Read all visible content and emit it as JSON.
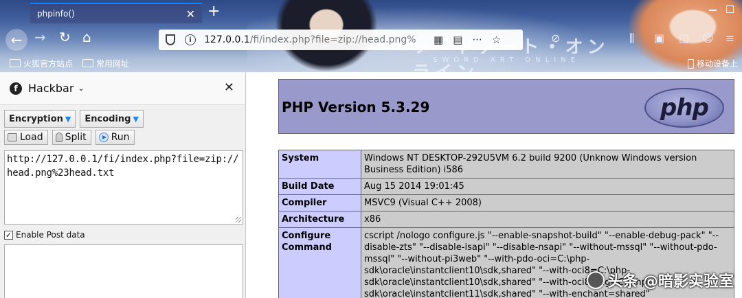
{
  "browser": {
    "tab_title": "phpinfo()",
    "tab_close": "✕",
    "new_tab": "+",
    "url_host": "127.0.0.1",
    "url_path": "/fi/index.php?file=zip://head.png%",
    "bookmarks": [
      "火狐官方站点",
      "常用网址"
    ],
    "mobile_bookmarks": "移动设备上",
    "theme_logo_jp": "ソードアート・オンライン",
    "theme_logo_en": "SWORD ART ONLINE"
  },
  "hackbar": {
    "title": "Hackbar",
    "close": "✕",
    "menus": [
      "Encryption",
      "Encoding"
    ],
    "actions": [
      "Load",
      "Split",
      "Run"
    ],
    "url_value": "http://127.0.0.1/fi/index.php?file=zip://head.png%23head.txt",
    "post_label": "Enable Post data",
    "post_checked": true,
    "post_value": ""
  },
  "phpinfo": {
    "title": "PHP Version 5.3.29",
    "logo_text": "php",
    "rows": [
      {
        "key": "System",
        "value": "Windows NT DESKTOP-292U5VM 6.2 build 9200 (Unknow Windows version Business Edition) i586"
      },
      {
        "key": "Build Date",
        "value": "Aug 15 2014 19:01:45"
      },
      {
        "key": "Compiler",
        "value": "MSVC9 (Visual C++ 2008)"
      },
      {
        "key": "Architecture",
        "value": "x86"
      },
      {
        "key": "Configure Command",
        "value": "cscript /nologo configure.js \"--enable-snapshot-build\" \"--enable-debug-pack\" \"--disable-zts\" \"--disable-isapi\" \"--disable-nsapi\" \"--without-mssql\" \"--without-pdo-mssql\" \"--without-pi3web\" \"--with-pdo-oci=C:\\php-sdk\\oracle\\instantclient10\\sdk,shared\" \"--with-oci8=C:\\php-sdk\\oracle\\instantclient10\\sdk,shared\" \"--with-oci8-11g=C:\\php-sdk\\oracle\\instantclient11\\sdk,shared\" \"--with-enchant=shared\""
      }
    ]
  },
  "watermark": "头条 @暗影实验室",
  "colors": {
    "php_header_bg": "#9999cc",
    "key_cell_bg": "#ccccff",
    "value_cell_bg": "#cccccc",
    "tab_accent": "#0a84ff"
  }
}
